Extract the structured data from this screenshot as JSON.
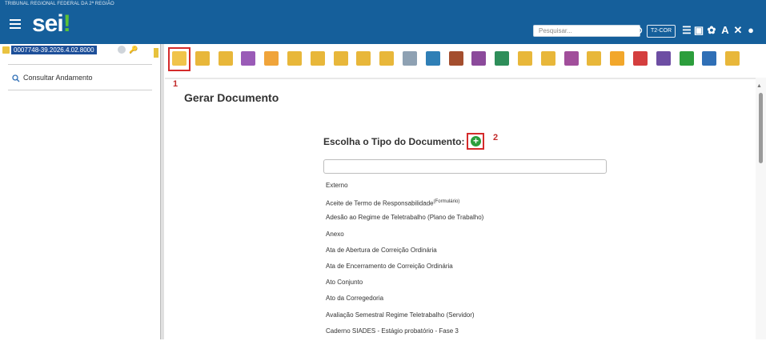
{
  "header": {
    "org_name": "TRIBUNAL REGIONAL FEDERAL DA 2ª REGIÃO",
    "logo_text": "sei",
    "logo_bang": "!",
    "search_placeholder": "Pesquisar...",
    "unit": "T2-COR",
    "icons": [
      "menu-icon",
      "search-icon",
      "list-icon",
      "calendar-icon",
      "gear-icon",
      "font-icon",
      "tools-icon",
      "user-icon"
    ]
  },
  "left_panel": {
    "process_number": "0007748-39.2026.4.02.8000",
    "menu_item": "Consultar Andamento"
  },
  "toolbar": {
    "icons": [
      {
        "name": "new-document-icon",
        "color": "#f0c44b"
      },
      {
        "name": "folder-refresh-icon",
        "color": "#e8b73a"
      },
      {
        "name": "folder-settings-icon",
        "color": "#e8b73a"
      },
      {
        "name": "eye-icon",
        "color": "#9a5bb7"
      },
      {
        "name": "thumbs-up-icon",
        "color": "#f0a43a"
      },
      {
        "name": "folder-arrow-icon",
        "color": "#e8b73a"
      },
      {
        "name": "folder-info-icon",
        "color": "#e8b73a"
      },
      {
        "name": "folder-users-icon",
        "color": "#e8b73a"
      },
      {
        "name": "folder-star-icon",
        "color": "#e8b73a"
      },
      {
        "name": "folder-open-icon",
        "color": "#e8b73a"
      },
      {
        "name": "mail-icon",
        "color": "#8ea1b3"
      },
      {
        "name": "sync-icon",
        "color": "#2f7fb6"
      },
      {
        "name": "briefcase-icon",
        "color": "#a44e2e"
      },
      {
        "name": "grid-icon",
        "color": "#8b4a9b"
      },
      {
        "name": "map-icon",
        "color": "#2e8e5a"
      },
      {
        "name": "document-list-icon",
        "color": "#e8b73a"
      },
      {
        "name": "folder-pause-icon",
        "color": "#e8b73a"
      },
      {
        "name": "link-icon",
        "color": "#a14e9b"
      },
      {
        "name": "folder-close-icon",
        "color": "#e8b73a"
      },
      {
        "name": "comment-icon",
        "color": "#f2a72b"
      },
      {
        "name": "trash-icon",
        "color": "#d43e3e"
      },
      {
        "name": "tag-icon",
        "color": "#6d4ea3"
      },
      {
        "name": "clock-icon",
        "color": "#2c9e3c"
      },
      {
        "name": "list-lines-icon",
        "color": "#2f6fb6"
      },
      {
        "name": "folder-search-icon",
        "color": "#e8b73a"
      }
    ]
  },
  "main": {
    "marker1": "1",
    "marker2": "2",
    "title": "Gerar Documento",
    "choose_label": "Escolha o Tipo do Documento:",
    "filter_value": "",
    "document_types": [
      {
        "label": "Externo",
        "sup": ""
      },
      {
        "label": "Aceite de Termo de Responsabilidade",
        "sup": "(Formulário)"
      },
      {
        "label": "Adesão ao Regime de Teletrabalho (Plano de Trabalho)",
        "sup": ""
      },
      {
        "label": "Anexo",
        "sup": ""
      },
      {
        "label": "Ata de Abertura de Correição Ordinária",
        "sup": ""
      },
      {
        "label": "Ata de Encerramento de Correição Ordinária",
        "sup": ""
      },
      {
        "label": "Ato Conjunto",
        "sup": ""
      },
      {
        "label": "Ato da Corregedoria",
        "sup": ""
      },
      {
        "label": "Avaliação Semestral Regime Teletrabalho (Servidor)",
        "sup": ""
      },
      {
        "label": "Caderno SIADES - Estágio probatório - Fase 3",
        "sup": ""
      }
    ]
  }
}
